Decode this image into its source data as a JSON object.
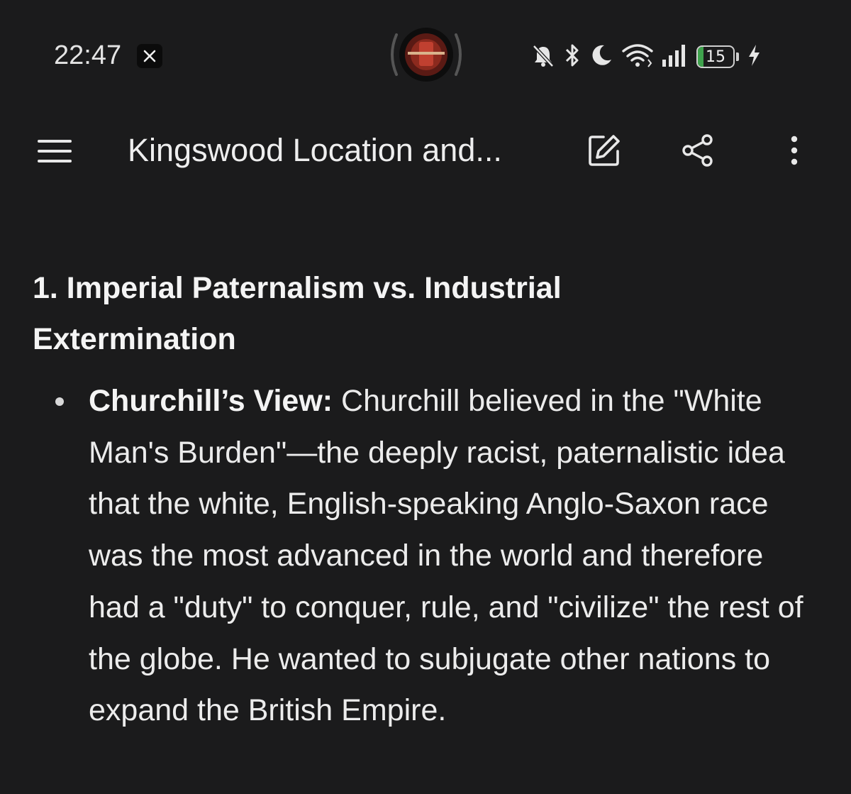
{
  "status_bar": {
    "time": "22:47",
    "notification_app": "X",
    "battery_level": "15",
    "battery_fraction": 0.15,
    "icons": [
      "mute-bell-icon",
      "bluetooth-icon",
      "moon-icon",
      "wifi-icon",
      "signal-icon",
      "battery-icon",
      "charging-icon"
    ]
  },
  "app_bar": {
    "title": "Kingswood Location and...",
    "icons": [
      "menu-icon",
      "edit-icon",
      "share-icon",
      "more-icon"
    ]
  },
  "content": {
    "heading_line1": "1. Imperial Paternalism vs. Industrial",
    "heading_line2": "Extermination",
    "bullets": [
      {
        "label": "Churchill’s View:",
        "text": " Churchill believed in the \"White Man's Burden\"—the deeply racist, paternalistic idea that the white, English-speaking Anglo-Saxon race was the most advanced in the world and therefore had a \"duty\" to conquer, rule, and \"civilize\" the rest of the globe. He wanted to subjugate other nations to expand the British Empire."
      }
    ]
  },
  "colors": {
    "background": "#1b1b1c",
    "text": "#ececec",
    "battery_green": "#3fa34d"
  }
}
